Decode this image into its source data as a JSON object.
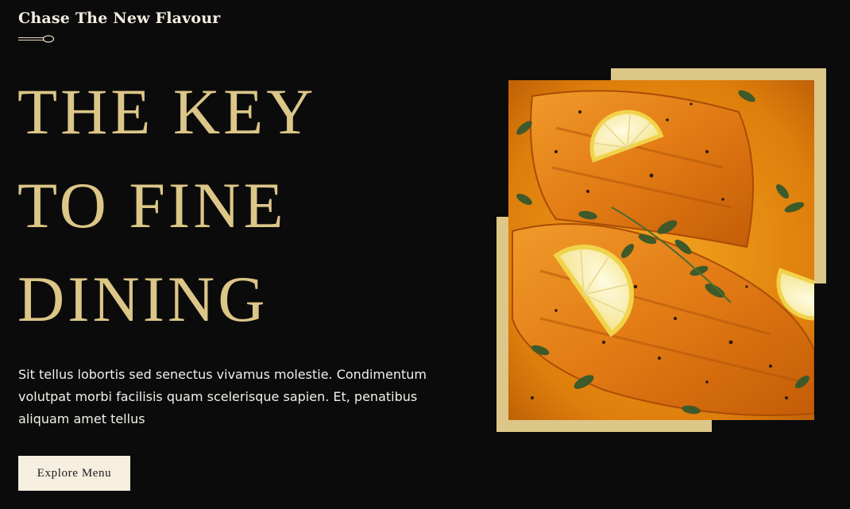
{
  "hero": {
    "tagline": "Chase The New Flavour",
    "headline": [
      "THE KEY",
      "TO FINE",
      "DINING"
    ],
    "description": "Sit tellus lobortis sed senectus vivamus molestie. Condimentum volutpat morbi facilisis quam scelerisque sapien. Et, penatibus aliquam amet tellus",
    "cta_label": "Explore Menu"
  },
  "colors": {
    "background": "#0b0b0b",
    "accent_gold": "#dcc688",
    "button_bg": "#f6efdf",
    "text_light": "#f3f0ea"
  },
  "icons": {
    "divider": "spoon-icon"
  },
  "image": {
    "subject": "salmon-fillets-with-lemon-and-herbs"
  }
}
